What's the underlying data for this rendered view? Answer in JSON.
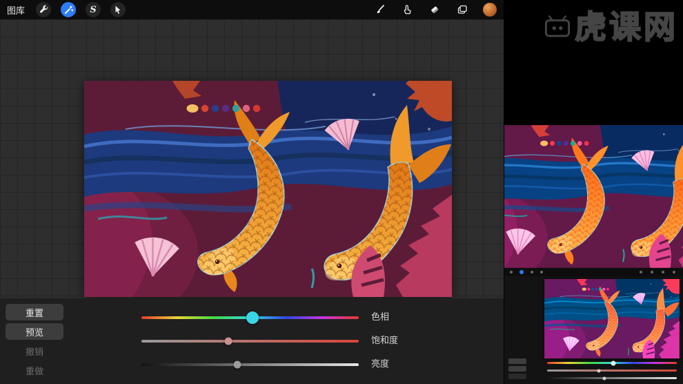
{
  "toolbar": {
    "gallery_label": "图库",
    "left_tools": [
      {
        "name": "actions-wrench"
      },
      {
        "name": "adjustments-wand",
        "active": true,
        "accent": "#2e7cf6"
      },
      {
        "name": "selection",
        "glyph": "S"
      },
      {
        "name": "transform-arrow"
      }
    ],
    "right_tools": [
      {
        "name": "brush"
      },
      {
        "name": "smudge"
      },
      {
        "name": "eraser"
      },
      {
        "name": "layers"
      },
      {
        "name": "color-swatch",
        "color": "#c06a2b"
      }
    ]
  },
  "adjust_panel": {
    "buttons": [
      {
        "label": "重置",
        "enabled": true
      },
      {
        "label": "预览",
        "enabled": true
      },
      {
        "label": "撤销",
        "enabled": false
      },
      {
        "label": "重做",
        "enabled": false
      }
    ],
    "sliders": [
      {
        "label": "色相",
        "value_pct": 51,
        "knob_color": "#3bd6e6",
        "track": "hue-rainbow"
      },
      {
        "label": "饱和度",
        "value_pct": 40,
        "knob_color": "#c9928e",
        "track": "gray-to-red"
      },
      {
        "label": "亮度",
        "value_pct": 44,
        "knob_color": "#9c9c9c",
        "track": "dark-to-light"
      }
    ]
  },
  "watermark": {
    "text": "虎课网"
  },
  "artwork": {
    "subject": "two orange koi fish with blue waves on maroon background",
    "palette_dots": [
      "#f2c061",
      "#d8432f",
      "#23418f",
      "#5a2d82",
      "#2f9f9a",
      "#e0607e",
      "#d8382c"
    ]
  }
}
